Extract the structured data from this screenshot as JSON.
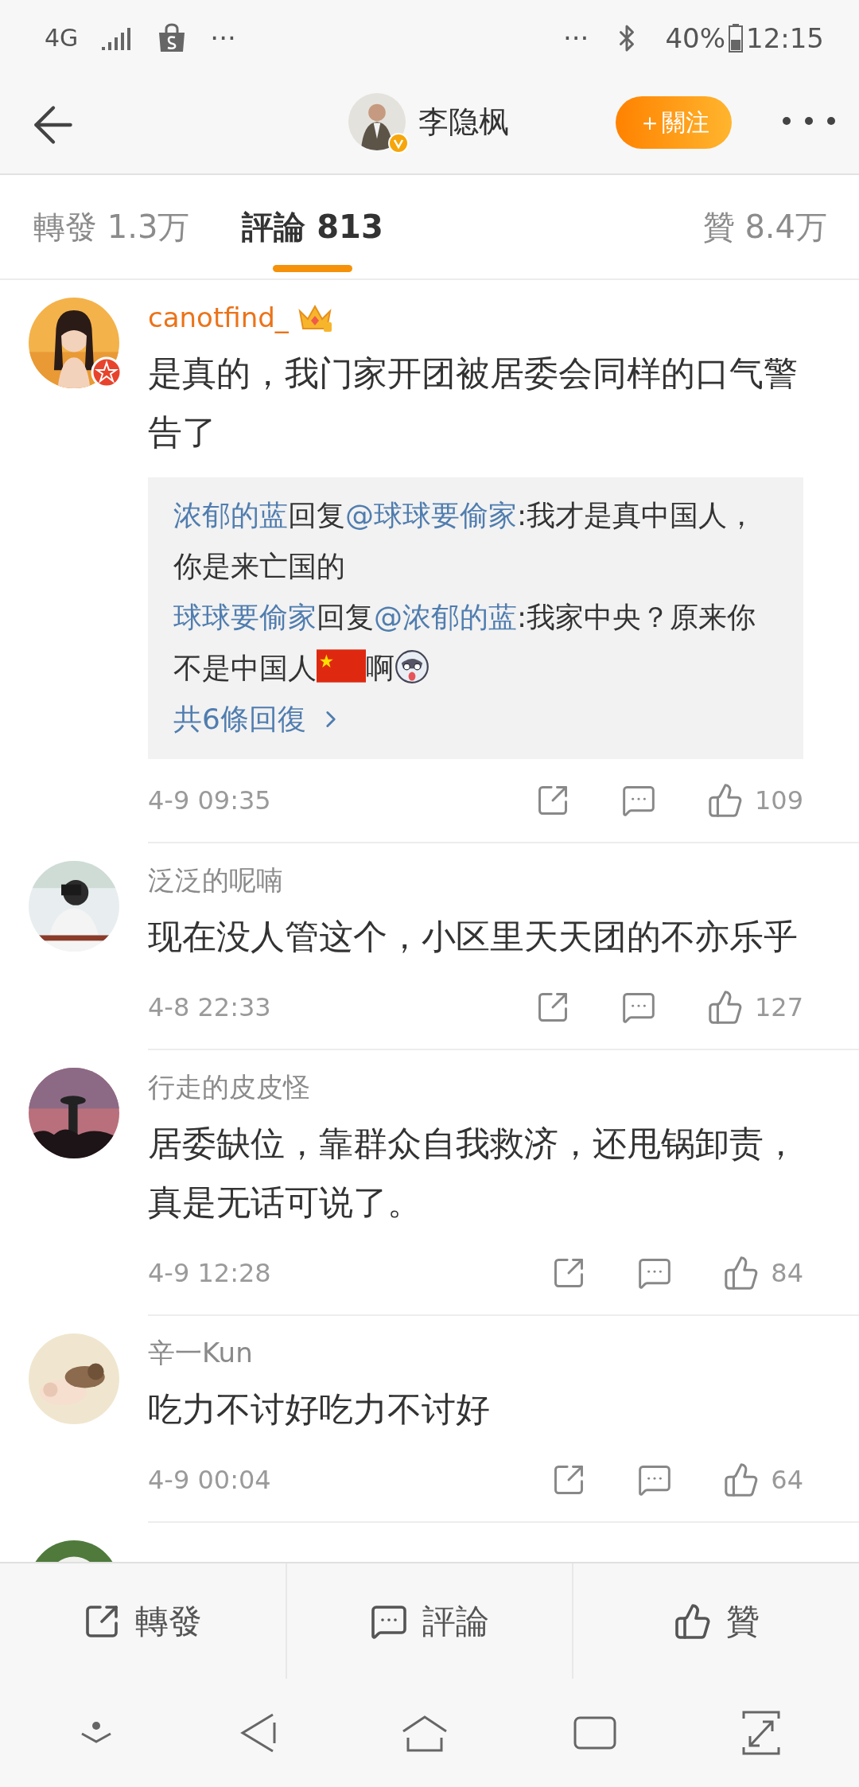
{
  "status_bar": {
    "network": "4G",
    "left_more": "···",
    "right_more": "···",
    "battery": "40%",
    "time": "12:15"
  },
  "header": {
    "title": "李隐枫",
    "follow_button": "＋關注"
  },
  "tabs": [
    {
      "label": "轉發 1.3万",
      "selected": false
    },
    {
      "label": "評論 813",
      "selected": true
    },
    {
      "label": "贊 8.4万",
      "selected": false
    }
  ],
  "comments": [
    {
      "author": "canotfind_",
      "vip": true,
      "badge": true,
      "text": "是真的，我门家开团被居委会同样的口气警告了",
      "replies": [
        {
          "author": "浓郁的蓝",
          "verb": "回复",
          "target": "@球球要偷家",
          "parts": [
            {
              "kind": "text",
              "text": ":我才是真中国人，你是来亡国的"
            }
          ]
        },
        {
          "author": "球球要偷家",
          "verb": "回复",
          "target": "@浓郁的蓝",
          "parts": [
            {
              "kind": "text",
              "text": ":我家中央？原来你不是中国人"
            },
            {
              "kind": "flag"
            },
            {
              "kind": "text",
              "text": "啊"
            },
            {
              "kind": "emoji"
            }
          ]
        }
      ],
      "more_replies": "共6條回復",
      "time": "4-9 09:35",
      "likes": "109"
    },
    {
      "author": "泛泛的呢喃",
      "vip": false,
      "badge": false,
      "text": "现在没人管这个，小区里天天团的不亦乐乎",
      "time": "4-8 22:33",
      "likes": "127"
    },
    {
      "author": "行走的皮皮怪",
      "vip": false,
      "badge": false,
      "text": "居委缺位，靠群众自我救济，还甩锅卸责，真是无话可说了。",
      "time": "4-9 12:28",
      "likes": "84"
    },
    {
      "author": "辛一Kun",
      "vip": false,
      "badge": false,
      "text": "吃力不讨好吃力不讨好",
      "time": "4-9 00:04",
      "likes": "64"
    },
    {
      "badge": false
    }
  ],
  "bottom_bar": [
    {
      "kind": "share",
      "label": "轉發"
    },
    {
      "kind": "comment",
      "label": "評論"
    },
    {
      "kind": "like",
      "label": "贊"
    }
  ]
}
